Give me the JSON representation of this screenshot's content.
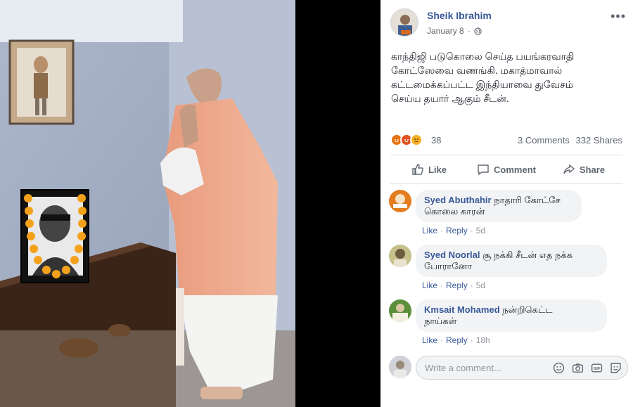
{
  "post": {
    "author": "Sheik Ibrahim",
    "date": "January 8",
    "text": "காந்திஜி படுகொலை செய்த பயங்கரவாதி\nகோட்ஸேவை வணங்கி. மகாத்மாவால்\nகட்டமைக்கப்பட்ட இந்தியாவை துவேசம்\nசெய்ய தயார் ஆகும் சீடன்.",
    "reaction_count": "38",
    "comments_count": "3 Comments",
    "shares_count": "332 Shares",
    "reaction_icons": [
      "angry-react-icon",
      "angry-react-icon",
      "sad-react-icon"
    ],
    "more_icon": "more-options-icon",
    "privacy_icon": "globe-icon"
  },
  "actions": {
    "like": "Like",
    "comment": "Comment",
    "share": "Share"
  },
  "comments": [
    {
      "name": "Syed Abuthahir",
      "text": "நாதாரி கோட்சே\nகொலை காரன்",
      "like": "Like",
      "reply": "Reply",
      "time": "5d"
    },
    {
      "name": "Syed Noorlal",
      "text": "சூ நக்கி சீடன் எத நக்க\nபோரானோ",
      "like": "Like",
      "reply": "Reply",
      "time": "5d"
    },
    {
      "name": "Kmsait Mohamed",
      "text": "நன்றிகெட்ட\nநாய்கள்",
      "like": "Like",
      "reply": "Reply",
      "time": "18h"
    }
  ],
  "composer": {
    "placeholder": "Write a comment...",
    "icons": [
      "emoji-icon",
      "camera-icon",
      "gif-icon",
      "sticker-icon"
    ]
  },
  "colors": {
    "link": "#385898",
    "muted": "#606770",
    "angry": "#e9710f",
    "sad": "#f7b125"
  }
}
